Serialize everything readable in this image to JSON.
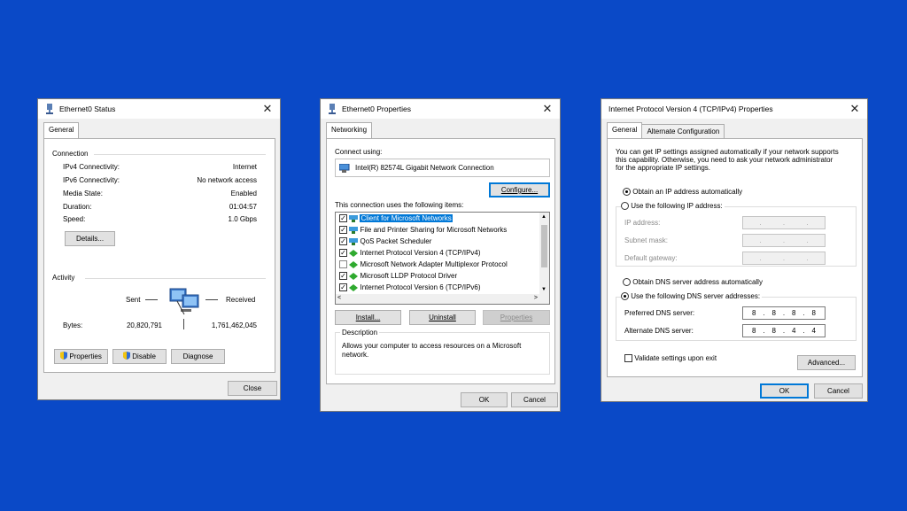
{
  "colors": {
    "desktop": "#0a49c7",
    "window_bg": "#f0f0f0",
    "accent": "#0078d7"
  },
  "status": {
    "title": "Ethernet0 Status",
    "tab": "General",
    "connection_header": "Connection",
    "rows": [
      {
        "label": "IPv4 Connectivity:",
        "value": "Internet"
      },
      {
        "label": "IPv6 Connectivity:",
        "value": "No network access"
      },
      {
        "label": "Media State:",
        "value": "Enabled"
      },
      {
        "label": "Duration:",
        "value": "01:04:57"
      },
      {
        "label": "Speed:",
        "value": "1.0 Gbps"
      }
    ],
    "details_btn": "Details...",
    "activity_header": "Activity",
    "sent_label": "Sent",
    "received_label": "Received",
    "bytes_label": "Bytes:",
    "bytes_sent": "20,820,791",
    "bytes_received": "1,761,462,045",
    "properties_btn": "Properties",
    "disable_btn": "Disable",
    "diagnose_btn": "Diagnose",
    "close_btn": "Close"
  },
  "props": {
    "title": "Ethernet0 Properties",
    "tab": "Networking",
    "connect_using_label": "Connect using:",
    "adapter": "Intel(R) 82574L Gigabit Network Connection",
    "configure_btn": "Configure...",
    "items_label": "This connection uses the following items:",
    "items": [
      {
        "label": "Client for Microsoft Networks",
        "checked": true,
        "selected": true
      },
      {
        "label": "File and Printer Sharing for Microsoft Networks",
        "checked": true
      },
      {
        "label": "QoS Packet Scheduler",
        "checked": true
      },
      {
        "label": "Internet Protocol Version 4 (TCP/IPv4)",
        "checked": true
      },
      {
        "label": "Microsoft Network Adapter Multiplexor Protocol",
        "checked": false
      },
      {
        "label": "Microsoft LLDP Protocol Driver",
        "checked": true
      },
      {
        "label": "Internet Protocol Version 6 (TCP/IPv6)",
        "checked": true
      }
    ],
    "install_btn": "Install...",
    "uninstall_btn": "Uninstall",
    "properties_btn": "Properties",
    "description_header": "Description",
    "description_line1": "Allows your computer to access resources on a Microsoft",
    "description_line2": "network.",
    "ok_btn": "OK",
    "cancel_btn": "Cancel"
  },
  "ipv4": {
    "title": "Internet Protocol Version 4 (TCP/IPv4) Properties",
    "tab_general": "General",
    "tab_alternate": "Alternate Configuration",
    "intro_line1": "You can get IP settings assigned automatically if your network supports",
    "intro_line2": "this capability. Otherwise, you need to ask your network administrator",
    "intro_line3": "for the appropriate IP settings.",
    "obtain_ip_auto": "Obtain an IP address automatically",
    "use_following_ip": "Use the following IP address:",
    "ip_address_label": "IP address:",
    "subnet_label": "Subnet mask:",
    "gateway_label": "Default gateway:",
    "obtain_dns_auto": "Obtain DNS server address automatically",
    "use_following_dns": "Use the following DNS server addresses:",
    "preferred_dns_label": "Preferred DNS server:",
    "alternate_dns_label": "Alternate DNS server:",
    "preferred_dns": [
      "8",
      "8",
      "8",
      "8"
    ],
    "alternate_dns": [
      "8",
      "8",
      "4",
      "4"
    ],
    "validate_label": "Validate settings upon exit",
    "advanced_btn": "Advanced...",
    "ok_btn": "OK",
    "cancel_btn": "Cancel"
  }
}
